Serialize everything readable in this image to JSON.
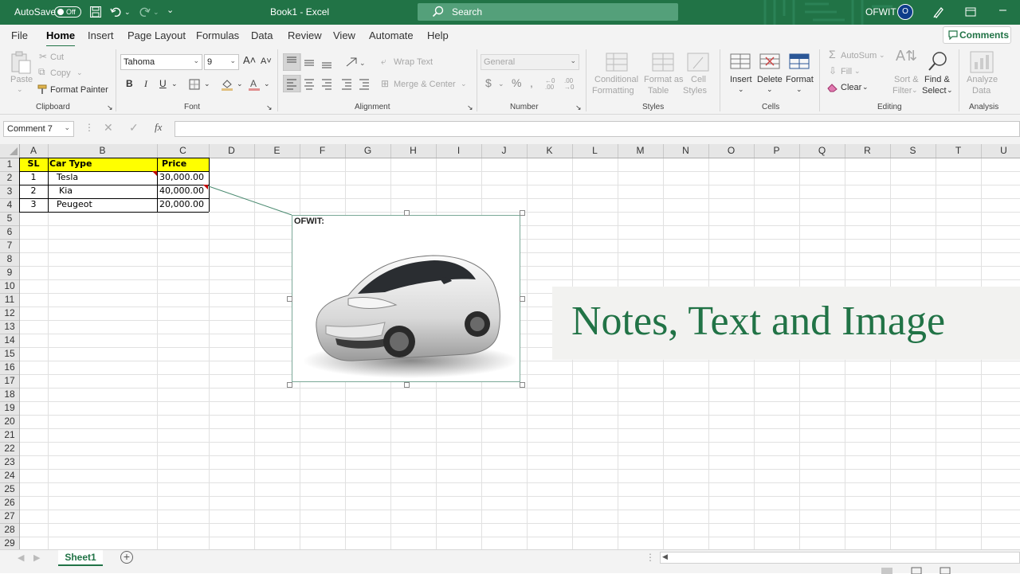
{
  "titlebar": {
    "autosave_label": "AutoSave",
    "autosave_state": "Off",
    "title": "Book1 - Excel",
    "search_placeholder": "Search",
    "user": "OFWIT",
    "avatar_initial": "O"
  },
  "tabs": [
    {
      "label": "File"
    },
    {
      "label": "Home"
    },
    {
      "label": "Insert"
    },
    {
      "label": "Page Layout"
    },
    {
      "label": "Formulas"
    },
    {
      "label": "Data"
    },
    {
      "label": "Review"
    },
    {
      "label": "View"
    },
    {
      "label": "Automate"
    },
    {
      "label": "Help"
    }
  ],
  "comments_label": "Comments",
  "ribbon": {
    "clipboard": {
      "paste": "Paste",
      "cut": "Cut",
      "copy": "Copy",
      "format_painter": "Format Painter",
      "group": "Clipboard"
    },
    "font": {
      "name": "Tahoma",
      "size": "9",
      "group": "Font"
    },
    "alignment": {
      "wrap": "Wrap Text",
      "merge": "Merge & Center",
      "group": "Alignment"
    },
    "number": {
      "format": "General",
      "group": "Number"
    },
    "styles": {
      "cond1": "Conditional",
      "cond2": "Formatting",
      "fmt1": "Format as",
      "fmt2": "Table",
      "cell1": "Cell",
      "cell2": "Styles",
      "group": "Styles"
    },
    "cells": {
      "insert": "Insert",
      "delete": "Delete",
      "format": "Format",
      "group": "Cells"
    },
    "editing": {
      "autosum": "AutoSum",
      "fill": "Fill",
      "clear": "Clear",
      "sort1": "Sort &",
      "sort2": "Filter",
      "find1": "Find &",
      "find2": "Select",
      "group": "Editing"
    },
    "analysis": {
      "an1": "Analyze",
      "an2": "Data",
      "group": "Analysis"
    }
  },
  "namebox": "Comment 7",
  "columns": [
    "A",
    "B",
    "C",
    "D",
    "E",
    "F",
    "G",
    "H",
    "I",
    "J",
    "K",
    "L",
    "M",
    "N",
    "O",
    "P",
    "Q",
    "R",
    "S",
    "T",
    "U"
  ],
  "rows": [
    "1",
    "2",
    "3",
    "4",
    "5",
    "6",
    "7",
    "8",
    "9",
    "10",
    "11",
    "12",
    "13",
    "14",
    "15",
    "16",
    "17",
    "18",
    "19",
    "20",
    "21",
    "22",
    "23",
    "24",
    "25",
    "26",
    "27",
    "28",
    "29"
  ],
  "table": {
    "headers": [
      "SL",
      "Car Type",
      "Price"
    ],
    "rows": [
      [
        "1",
        "Tesla",
        "30,000.00"
      ],
      [
        "2",
        "Kia",
        "40,000.00"
      ],
      [
        "3",
        "Peugeot",
        "20,000.00"
      ]
    ]
  },
  "note": {
    "author": "OFWIT:"
  },
  "banner": "Notes, Text and Image",
  "sheet_tab": "Sheet1",
  "colors": {
    "excel_green": "#217346",
    "header_yellow": "#ffff00"
  }
}
